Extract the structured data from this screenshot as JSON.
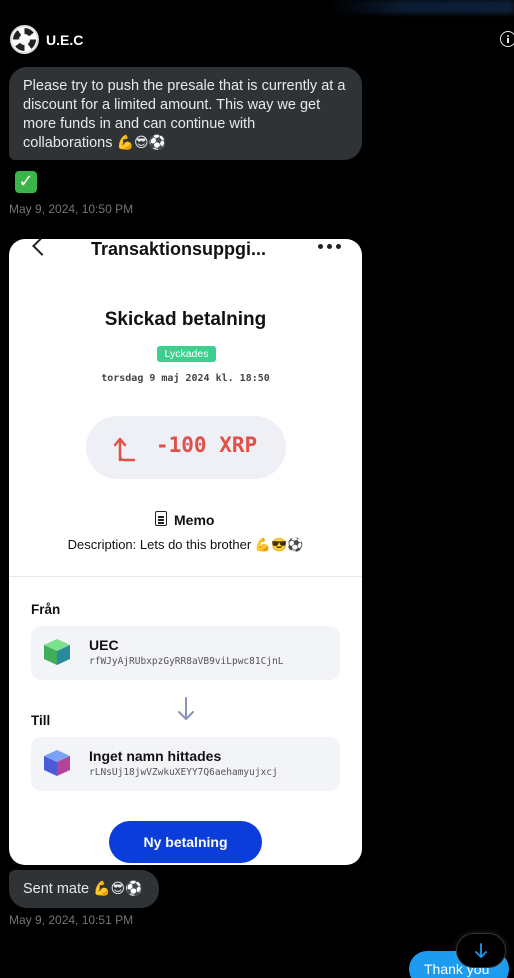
{
  "header": {
    "contact_name": "U.E.C",
    "avatar_text": "U.E.C"
  },
  "messages": {
    "msg1_text": "Please try to push the presale that is currently at a discount for a limited amount. This way we get more funds in and can continue with collaborations",
    "msg1_emojis": "💪😎⚽",
    "reaction_emoji": "✅",
    "timestamp1": "May 9, 2024, 10:50 PM",
    "msg2_text": "Sent mate",
    "msg2_emojis": "💪😎⚽",
    "timestamp2": "May 9, 2024, 10:51 PM",
    "reply_text": "Thank you"
  },
  "receipt": {
    "title": "Transaktionsuppgi...",
    "heading": "Skickad betalning",
    "status_badge": "Lyckades",
    "datetime": "torsdag 9 maj 2024 kl. 18:50",
    "amount": "-100 XRP",
    "amount_color": "#e0514a",
    "memo_label": "Memo",
    "memo_description": "Description: Lets do this brother 💪😎⚽",
    "from_label": "Från",
    "from_name": "UEC",
    "from_address": "rfWJyAjRUbxpzGyRR8aVB9viLpwc81CjnL",
    "to_label": "Till",
    "to_name": "Inget namn hittades",
    "to_address": "rLNsUj18jwVZwkuXEYY7Q6aehamyujxcj",
    "new_payment_button": "Ny betalning",
    "accent_color": "#0b3ddb",
    "success_color": "#3ccf8e"
  },
  "icons": [
    "info-icon",
    "back-chevron-icon",
    "more-dots-icon",
    "arrow-up-icon",
    "memo-document-icon",
    "green-cube-icon",
    "blue-cube-icon",
    "arrow-down-icon",
    "scroll-down-icon"
  ]
}
